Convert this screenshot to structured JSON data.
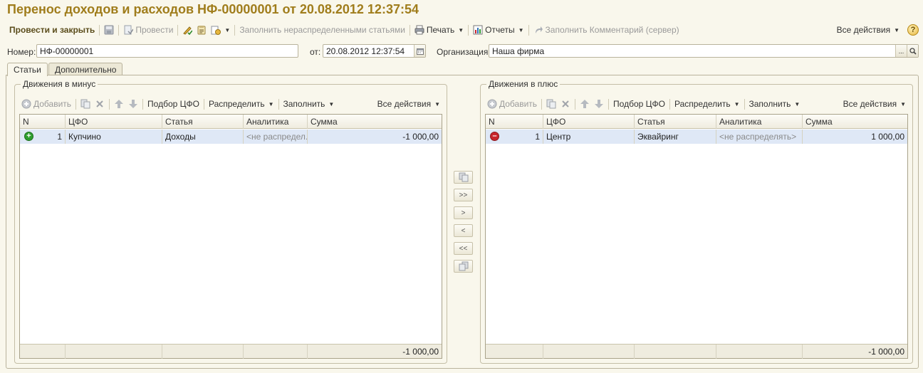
{
  "window": {
    "title": "Перенос доходов и расходов НФ-00000001 от 20.08.2012 12:37:54"
  },
  "toolbar": {
    "post_close": "Провести и закрыть",
    "post": "Провести",
    "fill_unallocated": "Заполнить нераспределенными статьями",
    "print": "Печать",
    "reports": "Отчеты",
    "fill_comment": "Заполнить Комментарий (сервер)",
    "all_actions": "Все действия",
    "help": "?"
  },
  "header": {
    "number_label": "Номер:",
    "number_value": "НФ-00000001",
    "date_label": "от:",
    "date_value": "20.08.2012 12:37:54",
    "org_label": "Организация:",
    "org_value": "Наша фирма",
    "org_select": "..."
  },
  "tabs": [
    {
      "label": "Статьи",
      "active": true
    },
    {
      "label": "Дополнительно",
      "active": false
    }
  ],
  "left_group": {
    "title": "Движения в минус",
    "toolbar": {
      "add": "Добавить",
      "pick": "Подбор ЦФО",
      "distribute": "Распределить",
      "fill": "Заполнить",
      "all_actions": "Все действия"
    },
    "columns": [
      "N",
      "ЦФО",
      "Статья",
      "Аналитика",
      "Сумма"
    ],
    "rows": [
      {
        "n": "1",
        "cfo": "Купчино",
        "article": "Доходы",
        "analytics": "<не распредел...",
        "sum": "-1 000,00",
        "icon": "plus-circle-icon"
      }
    ],
    "footer_total": "-1 000,00"
  },
  "right_group": {
    "title": "Движения в плюс",
    "toolbar": {
      "add": "Добавить",
      "pick": "Подбор ЦФО",
      "distribute": "Распределить",
      "fill": "Заполнить",
      "all_actions": "Все действия"
    },
    "columns": [
      "N",
      "ЦФО",
      "Статья",
      "Аналитика",
      "Сумма"
    ],
    "rows": [
      {
        "n": "1",
        "cfo": "Центр",
        "article": "Эквайринг",
        "analytics": "<не распределять>",
        "sum": "1 000,00",
        "icon": "minus-circle-icon"
      }
    ],
    "footer_total": "-1 000,00"
  },
  "transfer": {
    "move_all_right": ">>",
    "move_right": ">",
    "move_left": "<",
    "move_all_left": "<<"
  },
  "colors": {
    "title": "#a07d1c",
    "background": "#f9f7ec",
    "selected_row": "#dfe8f6"
  }
}
